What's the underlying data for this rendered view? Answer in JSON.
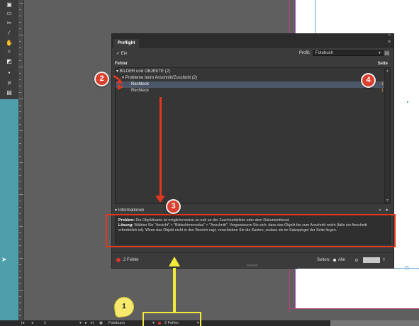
{
  "panel": {
    "tab_label": "Preflight",
    "on_label": "Ein",
    "profile_label": "Profil:",
    "profile_value": "Fotobuch",
    "col_errors": "Fehler",
    "col_page": "Seite",
    "rows": [
      {
        "label": "BILDER und OBJEKTE (2)",
        "page": ""
      },
      {
        "label": "Probleme beim Anschnitt/Zuschnitt (2)",
        "page": ""
      },
      {
        "label": "Rechteck",
        "page": "1"
      },
      {
        "label": "Rechteck",
        "page": "1"
      }
    ],
    "info_label": "Informationen",
    "info_problem_label": "Problem:",
    "info_problem_text": "Die Objektkante ist möglicherweise zu nah an der Zuschneidelinie oder dem Dokumentbund.",
    "info_solution_label": "Lösung:",
    "info_solution_text": "Wählen Sie \"Ansicht\" > \"Bildschirmmodus\" > \"Anschnitt\". Vergewissern Sie sich, dass das Objekt bis zum Anschnitt reicht (falls ein Anschnitt erforderlich ist). Wenn das Objekt nicht in den Bereich ragt, verschieben Sie die Kanten, sodass sie im Satzspiegel der Seite liegen.",
    "status_errors": "2 Fehler",
    "pages_label": "Seiten:",
    "pages_all": "Alle"
  },
  "appbar": {
    "page_num": "1",
    "profile": "Fotobuch",
    "errors": "2 Fehler"
  },
  "annotations": {
    "badge1": "1",
    "badge2": "2",
    "badge3": "3",
    "badge4": "4"
  },
  "colors": {
    "accent_red": "#e2381f",
    "highlight_yellow": "#f2ea3a",
    "error_dot": "#d63b2b",
    "page_number": "#e6a64a"
  }
}
